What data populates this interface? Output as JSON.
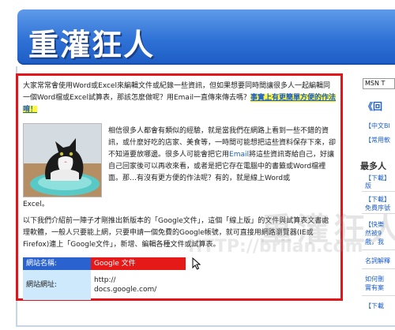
{
  "site": {
    "logo_text": "重灌狂人",
    "watermark_text": "重灌狂人",
    "watermark_url": "HTTP://briian.com"
  },
  "article": {
    "p1_text": "大家常常會使用Word或Excel來編輯文件或紀錄一些資訊，但如果想要同時間讓很多人一起編輯同一個Word檔或Excel試算表，那該怎麼做呢？用Email一直傳來傳去嗎？",
    "p1_highlight": "事實上有更簡單方便的作法唷！",
    "p2_before": "相信很多人都會有類似的經驗，就是當我們在網路上看到一些不錯的資訊，或什麼好吃的店家、美食等，一時間可能想把這些資料保存下來，卻不知道要放哪邊。很多人可能會把它用",
    "p2_link": "Email",
    "p2_after": "將這些資訊寄給自己，好讓自己回家後可以再收來看，或者是把它存在電腦中的書籤或Word檔裡面。那…有沒有更方便的作法呢？有的，就是線上Word或",
    "p3_text": "Excel。",
    "p4_text": "以下我們介紹前一陣子才剛推出新版本的「Google文件」，這個「線上版」的文件與試算表文書處理軟體，一般人只要能上網，只要申請一個免費的Google帳號，就可直接用網路瀏覽器(IE或Firefox)連上「Google文件」，新增、編輯各種文件或試算表。",
    "table": {
      "name_label": "網站名稱:",
      "name_value": "Google 文件",
      "url_label": "網站網址:",
      "url_value": "http://\ndocs.google.com/"
    }
  },
  "sidebar": {
    "search_value": "MSN T",
    "heading": "《回",
    "link1": "【中文Bl",
    "link2": "【常用軟",
    "title": "最多人",
    "item1": "【下載】",
    "item1b": "版",
    "item2": "【下載】",
    "item2b": "免費序號",
    "item3": "【快樂",
    "item3b": "然被9",
    "item3c": "戲，我",
    "item4": "名詞解釋",
    "item5": "如何刪",
    "item5b": "實有案",
    "item6": "【下載"
  },
  "colors": {
    "header_blue": "#2f72d6",
    "article_border": "#e3151b",
    "link_blue": "#1e5fc9",
    "highlight_yellow": "#fff83a",
    "label_blue": "#2a62cf",
    "value_red": "#e61919",
    "label_lightblue": "#cde9fb"
  }
}
